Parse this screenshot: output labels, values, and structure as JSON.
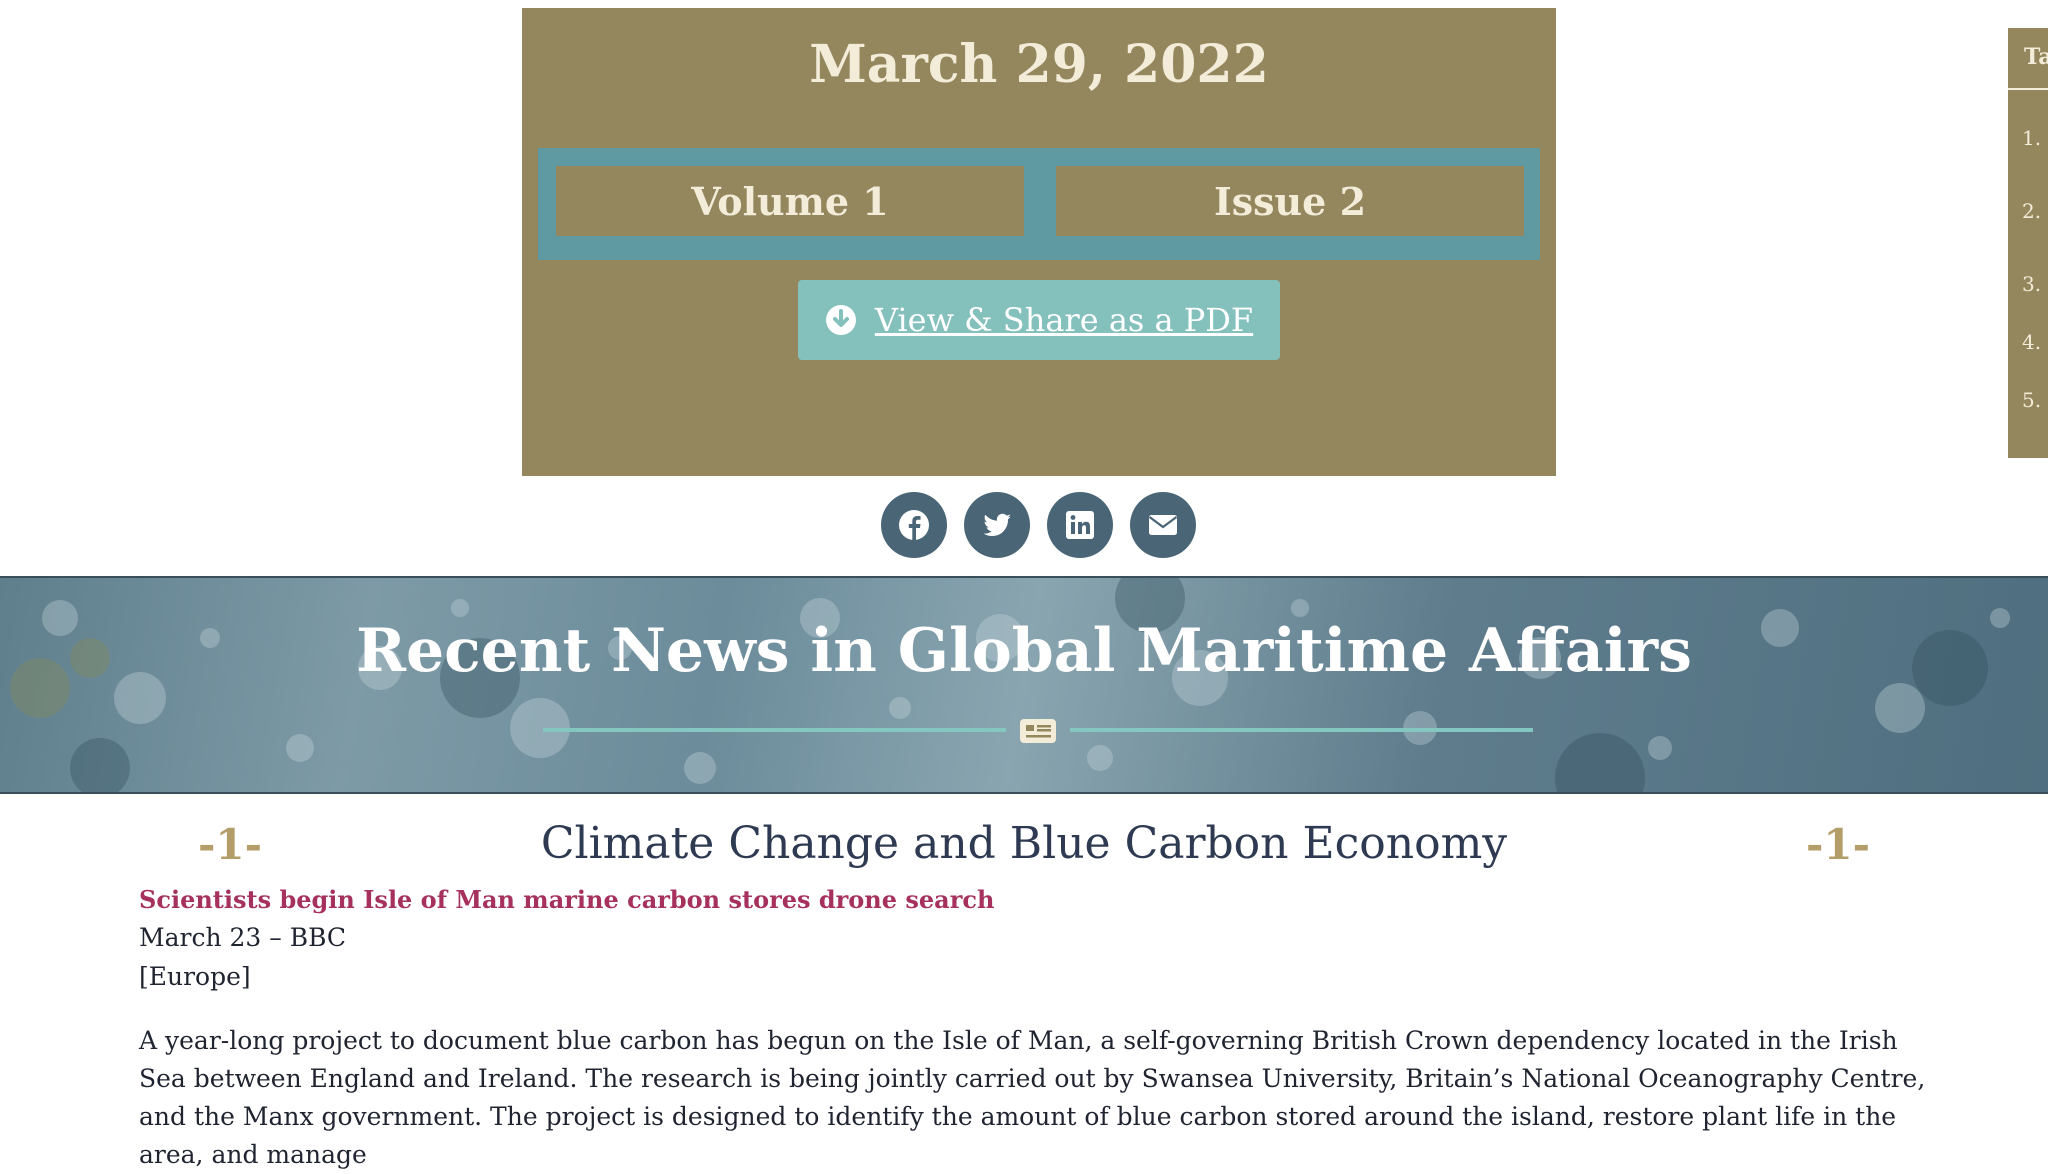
{
  "header": {
    "date": "March 29, 2022",
    "volume": "Volume 1",
    "issue": "Issue 2",
    "pdf_button": "View & Share as a PDF",
    "pdf_icon": "download-circle-icon"
  },
  "share": {
    "icons": [
      "facebook-icon",
      "twitter-icon",
      "linkedin-icon",
      "email-icon"
    ]
  },
  "toc": {
    "title": "Ta",
    "items": [
      "1.",
      "2.",
      "3.",
      "4.",
      "5."
    ]
  },
  "banner": {
    "title": "Recent News in Global Maritime Affairs",
    "icon": "newspaper-icon"
  },
  "section": {
    "number_left": "-1-",
    "number_right": "-1-",
    "title": "Climate Change and Blue Carbon Economy"
  },
  "article": {
    "headline": "Scientists begin Isle of Man marine carbon stores drone search",
    "dateline": "March 23 – BBC",
    "region": "[Europe]",
    "body": "A year-long project to document blue carbon has begun on the Isle of Man, a self-governing British Crown dependency located in the Irish Sea between England and Ireland. The research is being jointly carried out by Swansea University, Britain’s National Oceanography Centre, and the Manx government. The project is designed to identify the amount of blue carbon stored around the island, restore plant life in the area, and manage"
  },
  "colors": {
    "header_bg": "#94875e",
    "header_text": "#f2ecd9",
    "accent_teal": "#84c1bd",
    "social_bg": "#4a6676",
    "link": "#a5315c",
    "section_number": "#b39e69",
    "section_title": "#2e3a52"
  }
}
